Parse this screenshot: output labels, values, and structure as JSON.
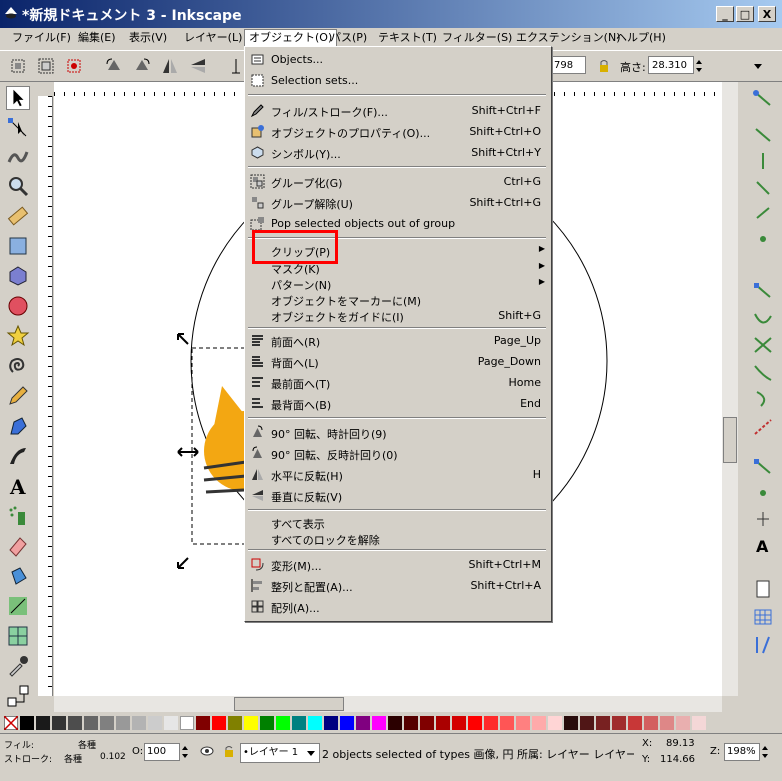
{
  "window": {
    "title": "*新規ドキュメント 3 - Inkscape",
    "btn_min": "_",
    "btn_max": "□",
    "btn_close": "X"
  },
  "menubar": [
    "ファイル(F)",
    "編集(E)",
    "表示(V)",
    "レイヤー(L)",
    "オブジェクト(O)",
    "パス(P)",
    "テキスト(T)",
    "フィルター(S)",
    "エクステンション(N)",
    "ヘルプ(H)"
  ],
  "toolbar": {
    "w_value": "798",
    "h_label": "高さ:",
    "h_value": "28.310"
  },
  "object_menu": {
    "items": [
      {
        "label": "Objects...",
        "accel": "",
        "icon": "objects-icon"
      },
      {
        "label": "Selection sets...",
        "accel": "",
        "icon": "selection-sets-icon"
      },
      {
        "label": "フィル/ストローク(F)...",
        "accel": "Shift+Ctrl+F",
        "icon": "fill-stroke-icon"
      },
      {
        "label": "オブジェクトのプロパティ(O)...",
        "accel": "Shift+Ctrl+O",
        "icon": "object-properties-icon"
      },
      {
        "label": "シンボル(Y)...",
        "accel": "Shift+Ctrl+Y",
        "icon": "symbols-icon"
      },
      {
        "label": "グループ化(G)",
        "accel": "Ctrl+G",
        "icon": "group-icon"
      },
      {
        "label": "グループ解除(U)",
        "accel": "Shift+Ctrl+G",
        "icon": "ungroup-icon"
      },
      {
        "label": "Pop selected objects out of group",
        "accel": "",
        "icon": "pop-out-icon"
      },
      {
        "label": "クリップ(P)",
        "accel": "",
        "icon": ""
      },
      {
        "label": "マスク(K)",
        "accel": "",
        "icon": ""
      },
      {
        "label": "パターン(N)",
        "accel": "",
        "icon": ""
      },
      {
        "label": "オブジェクトをマーカーに(M)",
        "accel": "",
        "icon": ""
      },
      {
        "label": "オブジェクトをガイドに(I)",
        "accel": "Shift+G",
        "icon": ""
      },
      {
        "label": "前面へ(R)",
        "accel": "Page_Up",
        "icon": "raise-icon"
      },
      {
        "label": "背面へ(L)",
        "accel": "Page_Down",
        "icon": "lower-icon"
      },
      {
        "label": "最前面へ(T)",
        "accel": "Home",
        "icon": "raise-top-icon"
      },
      {
        "label": "最背面へ(B)",
        "accel": "End",
        "icon": "lower-bottom-icon"
      },
      {
        "label": "90° 回転、時計回り(9)",
        "accel": "",
        "icon": "rotate-cw-icon"
      },
      {
        "label": "90° 回転、反時計回り(0)",
        "accel": "",
        "icon": "rotate-ccw-icon"
      },
      {
        "label": "水平に反転(H)",
        "accel": "H",
        "icon": "flip-horizontal-icon"
      },
      {
        "label": "垂直に反転(V)",
        "accel": "",
        "icon": "flip-vertical-icon"
      },
      {
        "label": "すべて表示",
        "accel": "",
        "icon": ""
      },
      {
        "label": "すべてのロックを解除",
        "accel": "",
        "icon": ""
      },
      {
        "label": "変形(M)...",
        "accel": "Shift+Ctrl+M",
        "icon": "transform-icon"
      },
      {
        "label": "整列と配置(A)...",
        "accel": "Shift+Ctrl+A",
        "icon": "align-icon"
      },
      {
        "label": "配列(A)...",
        "accel": "",
        "icon": "arrange-icon"
      }
    ]
  },
  "status": {
    "fill_label": "フィル:",
    "fill_value": "各種",
    "stroke_label": "ストローク:",
    "stroke_value": "各種",
    "stroke_width": "0.102",
    "opacity_label": "O:",
    "opacity_value": "100",
    "layer_value": "•レイヤー 1",
    "message": "2 objects selected of types 画像, 円 所属: レイヤー レイヤー",
    "x_label": "X:",
    "x_value": "89.13",
    "y_label": "Y:",
    "y_value": "114.66",
    "zoom_label": "Z:",
    "zoom_value": "198%"
  },
  "colors": {
    "title_start": "#0a246a",
    "title_end": "#a6caf0",
    "highlight": "#ff0000"
  }
}
